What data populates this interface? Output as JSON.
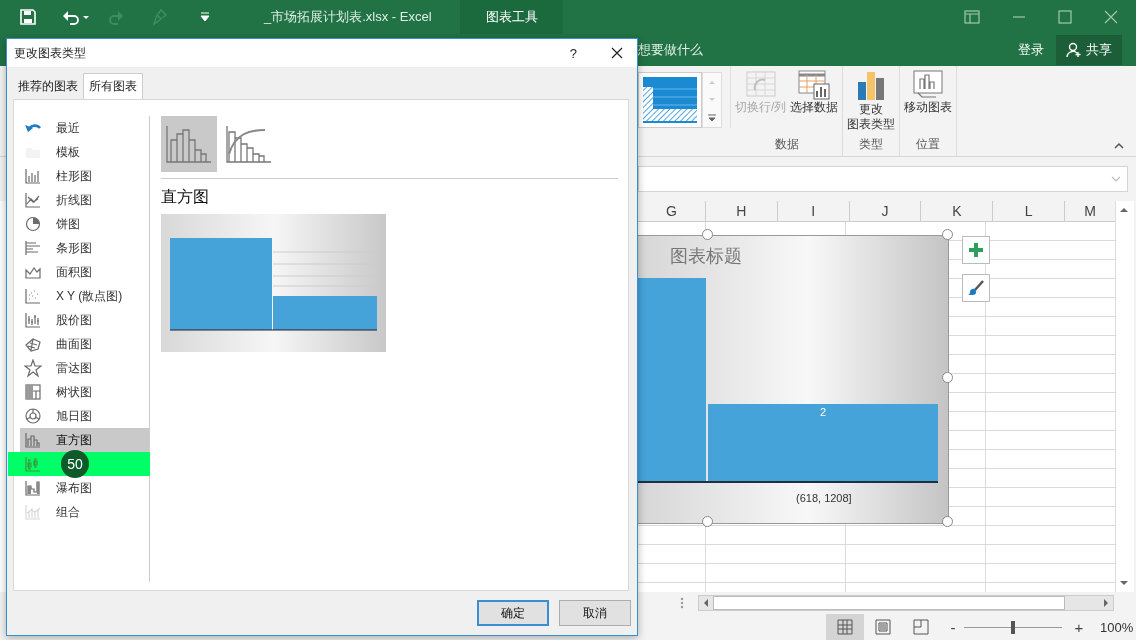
{
  "title_bar": {
    "title": "_市场拓展计划表.xlsx - Excel",
    "context_tab": "图表工具",
    "redo_disabled": true
  },
  "tell_me": "想要做什么",
  "account": {
    "sign_in": "登录",
    "share": "共享"
  },
  "ribbon": {
    "groups": [
      {
        "label": "数据",
        "buttons": [
          {
            "lines": [
              "切换行/列"
            ],
            "disabled": true
          },
          {
            "lines": [
              "选择数据"
            ],
            "disabled": false
          }
        ]
      },
      {
        "label": "类型",
        "buttons": [
          {
            "lines": [
              "更改",
              "图表类型"
            ],
            "disabled": false
          }
        ]
      },
      {
        "label": "位置",
        "buttons": [
          {
            "lines": [
              "移动图表"
            ],
            "disabled": false
          }
        ]
      }
    ]
  },
  "sheet": {
    "columns": [
      "G",
      "H",
      "I",
      "J",
      "K",
      "L",
      "M"
    ]
  },
  "chart": {
    "title": "图表标题",
    "data_label": "2",
    "axis_label": "(618, 1208]"
  },
  "status_bar": {
    "views": [
      {
        "selected": true
      },
      {
        "selected": false
      },
      {
        "selected": false
      }
    ],
    "zoom_out": "-",
    "zoom_in": "+",
    "zoom": {
      "level": 0.5
    },
    "zoom_text": "100%"
  },
  "dialog": {
    "title": "更改图表类型",
    "help": "?",
    "tabs": [
      {
        "label": "推荐的图表",
        "selected": false
      },
      {
        "label": "所有图表",
        "selected": true
      }
    ],
    "chart_types": [
      {
        "label": "最近",
        "selected": false,
        "highlighted": false,
        "disabled": false
      },
      {
        "label": "模板",
        "selected": false,
        "highlighted": false,
        "disabled": true
      },
      {
        "label": "柱形图",
        "selected": false,
        "highlighted": false,
        "disabled": false
      },
      {
        "label": "折线图",
        "selected": false,
        "highlighted": false,
        "disabled": false
      },
      {
        "label": "饼图",
        "selected": false,
        "highlighted": false,
        "disabled": false
      },
      {
        "label": "条形图",
        "selected": false,
        "highlighted": false,
        "disabled": false
      },
      {
        "label": "面积图",
        "selected": false,
        "highlighted": false,
        "disabled": false
      },
      {
        "label": "X Y (散点图)",
        "selected": false,
        "highlighted": false,
        "disabled": false
      },
      {
        "label": "股价图",
        "selected": false,
        "highlighted": false,
        "disabled": false
      },
      {
        "label": "曲面图",
        "selected": false,
        "highlighted": false,
        "disabled": false
      },
      {
        "label": "雷达图",
        "selected": false,
        "highlighted": false,
        "disabled": false
      },
      {
        "label": "树状图",
        "selected": false,
        "highlighted": false,
        "disabled": false
      },
      {
        "label": "旭日图",
        "selected": false,
        "highlighted": false,
        "disabled": false
      },
      {
        "label": "直方图",
        "selected": true,
        "highlighted": false,
        "disabled": false
      },
      {
        "selected": false,
        "highlighted": true,
        "badge": "50",
        "disabled": false
      },
      {
        "label": "瀑布图",
        "selected": false,
        "highlighted": false,
        "disabled": false
      },
      {
        "label": "组合",
        "selected": false,
        "highlighted": false,
        "disabled": true
      }
    ],
    "subtypes": [
      {
        "selected": true
      },
      {
        "selected": false
      }
    ],
    "heading": "直方图",
    "buttons": [
      {
        "label": "确定",
        "default": true
      },
      {
        "label": "取消",
        "default": false
      }
    ]
  }
}
